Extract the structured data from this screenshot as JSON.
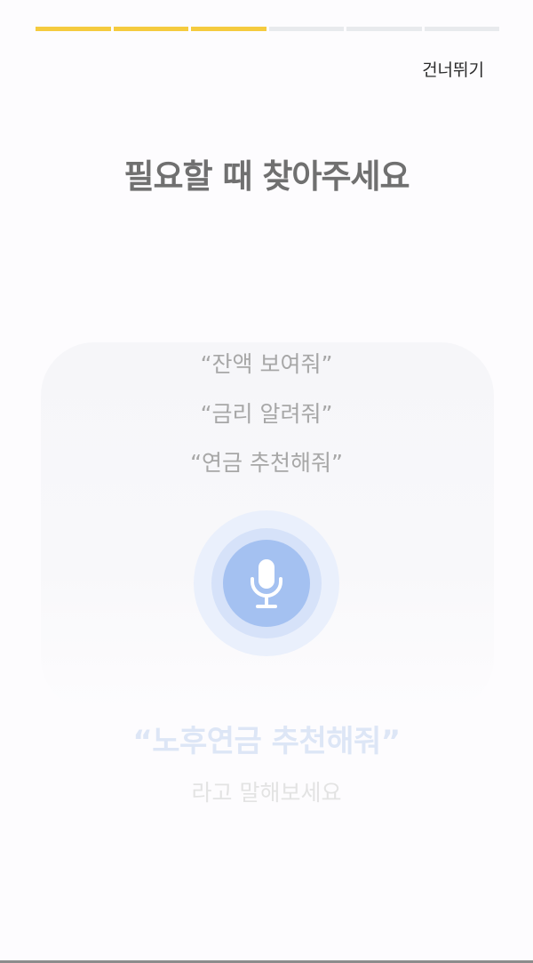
{
  "progress": {
    "total_steps": 6,
    "completed_steps": 3,
    "active_color": "#f5cb3f",
    "inactive_color": "#e8eaed"
  },
  "header": {
    "skip_label": "건너뛰기"
  },
  "title": "필요할 때 찾아주세요",
  "examples": [
    "“잔액 보여줘”",
    "“금리 알려줘”",
    "“연금 추천해줘”"
  ],
  "mic": {
    "icon": "microphone-icon",
    "color": "#a4c1f1"
  },
  "prompt": "“노후연금 추천해줘”",
  "hint": "라고 말해보세요"
}
